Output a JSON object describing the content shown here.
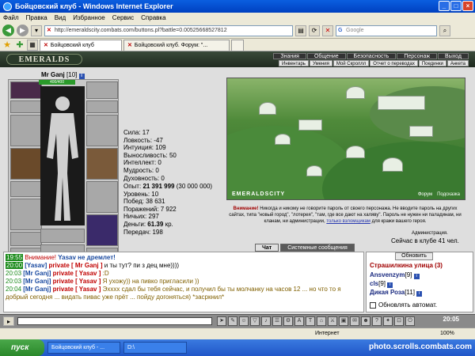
{
  "window": {
    "title": "Бойцовский клуб - Windows Internet Explorer"
  },
  "menu": [
    "Файл",
    "Правка",
    "Вид",
    "Избранное",
    "Сервис",
    "Справка"
  ],
  "address": {
    "url": "http://emeraldscity.combats.com/buttons.pl?battle=0.00525668527812",
    "search_placeholder": "Google"
  },
  "tabs": [
    "Бойцовский клуб",
    "Бойцовский клуб. Форум: \"..."
  ],
  "game": {
    "logo": "EMERALDS",
    "top_menu": [
      "Знания",
      "Общение",
      "Безопасность",
      "Персонаж",
      "Выход"
    ],
    "sub_menu": [
      "Инвентарь",
      "Умения",
      "Мой Скроллл",
      "Отчет о переводах",
      "Поединки",
      "Анкета"
    ],
    "character": {
      "name": "Mr Ganj",
      "level": "[10]",
      "hp": "400/400",
      "stats": [
        "Сила: 17",
        "Ловкость: -47",
        "Интуиция: 109",
        "Выносливость: 50",
        "Интеллект: 0",
        "Мудрость: 0",
        "Духовность: 0"
      ],
      "exp_label": "Опыт:",
      "exp_value": "21 391 999",
      "exp_next": "(30 000 000)",
      "info": [
        "Уровень: 10",
        "Побед: 38 631",
        "Поражений: 7 922",
        "Ничьих: 297"
      ],
      "money_label": "Деньги:",
      "money_value": "61.39",
      "money_unit": "кр.",
      "transfers": "Передач: 198"
    },
    "scene": {
      "label": "EMERALDSCITY",
      "link_forum": "Форум",
      "link_help": "Подсказка"
    },
    "warning": {
      "prefix": "Внимание!",
      "text": "Никогда и никому не говорите пароль от своего персонажа. Не вводите пароль на других сайтах, типа \"новый город\", \"лотерея\", \"там, где все дают на халяву\". Пароль не нужен ни паладинам, ни кланам, ни администрации,",
      "link": "только взломщикам",
      "suffix": "для кражи вашего героя.",
      "admin": "Администрация."
    },
    "online": "Сейчас в клубе 41 чел.",
    "chat_tabs": [
      "Чат",
      "Системные сообщения"
    ],
    "chat": [
      {
        "time": "19:55",
        "user": "",
        "priv": "",
        "text_warn": "Внимание!",
        "text": " Yasav не дремлет!"
      },
      {
        "time": "20:00",
        "user": "[Yasav]",
        "priv": "private [ Mr Ganj ]",
        "text_warn": "",
        "text": " и ты тут? пи з дец мне))))"
      },
      {
        "time": "20:03",
        "user": "[Mr Ganj]",
        "priv": "private [ Yasav ]",
        "text_warn": "",
        "text": " :D"
      },
      {
        "time": "20:03",
        "user": "[Mr Ganj]",
        "priv": "private [ Yasav ]",
        "text_warn": "",
        "text": " Я ухожу)) на пивко пригласили ))"
      },
      {
        "time": "20:04",
        "user": "[Mr Ganj]",
        "priv": "private [ Yasav ]",
        "text_warn": "",
        "text": " Эхххх сдал бы тебя сейчас, и получил бы ты молчанку на часов 12 ... но что то я добрый сегодня ... видать пивас уже прёт ... пойду догоняться) *засркнил*"
      }
    ],
    "room": {
      "refresh": "Обновить",
      "title": "Страшилкина улица (3)",
      "users": [
        {
          "name": "Ansvenzym",
          "level": "[9]"
        },
        {
          "name": "cls",
          "level": "[9]"
        },
        {
          "name": "Дикая Роза",
          "level": "[11]"
        }
      ],
      "auto_refresh": "Обновлять автомат."
    },
    "clock": "20:05"
  },
  "status": {
    "zone": "Интернет",
    "zoom": "100%"
  },
  "taskbar": {
    "start": "пуск",
    "items": [
      "Бойцовский клуб - ...",
      "D:\\"
    ],
    "watermark": "photo.scrolls.combats.com"
  },
  "colors": {
    "title_blue": "#0040c0",
    "green_time": "#1a8a1a",
    "private_red": "#c00000",
    "user_blue": "#1a4aa0"
  }
}
